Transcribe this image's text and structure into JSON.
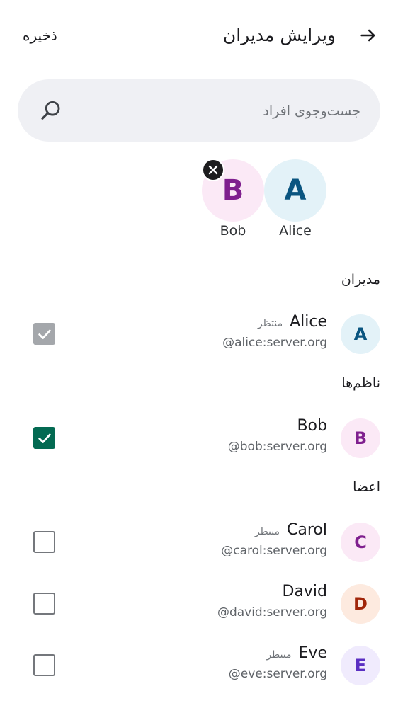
{
  "header": {
    "title": "ویرایش مدیران",
    "save_label": "ذخیره",
    "back_icon": "arrow-right-icon"
  },
  "search": {
    "placeholder": "جست‌وجوی افراد",
    "value": "",
    "icon": "search-icon"
  },
  "selected": [
    {
      "letter": "A",
      "name": "Alice",
      "bg": "#e3f2f8",
      "fg": "#0a5580"
    },
    {
      "letter": "B",
      "name": "Bob",
      "bg": "#fbe9f6",
      "fg": "#7f1f8e",
      "removable": true
    }
  ],
  "sections": {
    "admins": "مدیران",
    "moderators": "ناظم‌ها",
    "members": "اعضا"
  },
  "pending_label": "منتظر",
  "rows": [
    {
      "letter": "A",
      "name": "Alice",
      "user_id": "@alice:server.org",
      "pending": true,
      "checkbox": "checked-disabled",
      "bg": "#e3f2f8",
      "fg": "#0a5580"
    },
    {
      "letter": "B",
      "name": "Bob",
      "user_id": "@bob:server.org",
      "pending": false,
      "checkbox": "checked",
      "bg": "#fbe9f6",
      "fg": "#7f1f8e"
    },
    {
      "letter": "C",
      "name": "Carol",
      "user_id": "@carol:server.org",
      "pending": true,
      "checkbox": "unchecked",
      "bg": "#fbe9f6",
      "fg": "#7f1f8e"
    },
    {
      "letter": "D",
      "name": "David",
      "user_id": "@david:server.org",
      "pending": false,
      "checkbox": "unchecked",
      "bg": "#fdeadf",
      "fg": "#a0260a"
    },
    {
      "letter": "E",
      "name": "Eve",
      "user_id": "@eve:server.org",
      "pending": true,
      "checkbox": "unchecked",
      "bg": "#f0ebfd",
      "fg": "#5a2fc2"
    }
  ],
  "colors": {
    "accent": "#036a52",
    "disabled_check": "#a4a7ab",
    "search_bg": "#eff0f4"
  }
}
